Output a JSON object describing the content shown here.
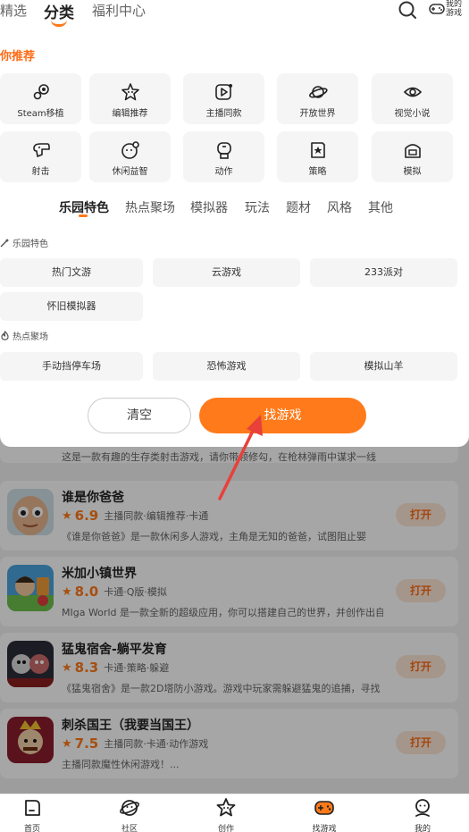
{
  "top_nav": {
    "tabs": [
      {
        "label": "精选",
        "active": false
      },
      {
        "label": "分类",
        "active": true
      },
      {
        "label": "福利中心",
        "active": false
      }
    ],
    "search_icon": "search-icon",
    "my_games_line1": "我的",
    "my_games_line2": "游戏"
  },
  "recommend": {
    "title": "为你推荐",
    "items": [
      {
        "label": "Steam移植",
        "icon": "steam-icon"
      },
      {
        "label": "编辑推荐",
        "icon": "star-badge-icon"
      },
      {
        "label": "主播同款",
        "icon": "video-play-icon"
      },
      {
        "label": "开放世界",
        "icon": "planet-icon"
      },
      {
        "label": "视觉小说",
        "icon": "eye-icon"
      },
      {
        "label": "射击",
        "icon": "gun-icon"
      },
      {
        "label": "休闲益智",
        "icon": "puzzle-icon"
      },
      {
        "label": "动作",
        "icon": "fist-icon"
      },
      {
        "label": "策略",
        "icon": "strategy-icon"
      },
      {
        "label": "模拟",
        "icon": "simulation-icon"
      }
    ]
  },
  "filter_tabs": [
    {
      "label": "乐园特色",
      "active": true
    },
    {
      "label": "热点聚场",
      "active": false
    },
    {
      "label": "模拟器",
      "active": false
    },
    {
      "label": "玩法",
      "active": false
    },
    {
      "label": "题材",
      "active": false
    },
    {
      "label": "风格",
      "active": false
    },
    {
      "label": "其他",
      "active": false
    }
  ],
  "feature_section": {
    "heading": "乐园特色",
    "chips": [
      "热门文游",
      "云游戏",
      "233派对",
      "怀旧模拟器"
    ]
  },
  "hot_section": {
    "heading": "热点聚场",
    "chips": [
      "手动挡停车场",
      "恐怖游戏",
      "模拟山羊"
    ]
  },
  "actions": {
    "clear_label": "清空",
    "find_label": "找游戏"
  },
  "games": [
    {
      "name": "",
      "score": "",
      "tags": "",
      "desc": "这是一款有趣的生存类射击游戏，请你带领修勾，在枪林弹雨中谋求一线",
      "open_label": ""
    },
    {
      "name": "谁是你爸爸",
      "score": "6.9",
      "tags": "主播同款·编辑推荐·卡通",
      "desc": "《谁是你爸爸》是一款休闲多人游戏，主角是无知的爸爸，试图阻止婴",
      "open_label": "打开"
    },
    {
      "name": "米加小镇世界",
      "score": "8.0",
      "tags": "卡通·Q版·模拟",
      "desc": "MIga World 是一款全新的超级应用，你可以搭建自己的世界，并创作出自",
      "open_label": "打开"
    },
    {
      "name": "猛鬼宿舍-躺平发育",
      "score": "8.3",
      "tags": "卡通·策略·躲避",
      "desc": "《猛鬼宿舍》是一款2D塔防小游戏。游戏中玩家需躲避猛鬼的追捕，寻找",
      "open_label": "打开"
    },
    {
      "name": "刺杀国王（我要当国王）",
      "score": "7.5",
      "tags": "主播同款·卡通·动作游戏",
      "desc": "主播同款魔性休闲游戏！...",
      "open_label": "打开"
    }
  ],
  "bottom_nav": [
    {
      "label": "首页",
      "icon": "home-icon"
    },
    {
      "label": "社区",
      "icon": "community-icon"
    },
    {
      "label": "创作",
      "icon": "create-star-icon"
    },
    {
      "label": "找游戏",
      "icon": "gamepad-icon"
    },
    {
      "label": "我的",
      "icon": "profile-icon"
    }
  ],
  "colors": {
    "accent": "#ff7a1a",
    "accent_text": "#ff6a13",
    "chip_bg": "#f5f5f5",
    "open_button_bg": "#fde7d6"
  }
}
